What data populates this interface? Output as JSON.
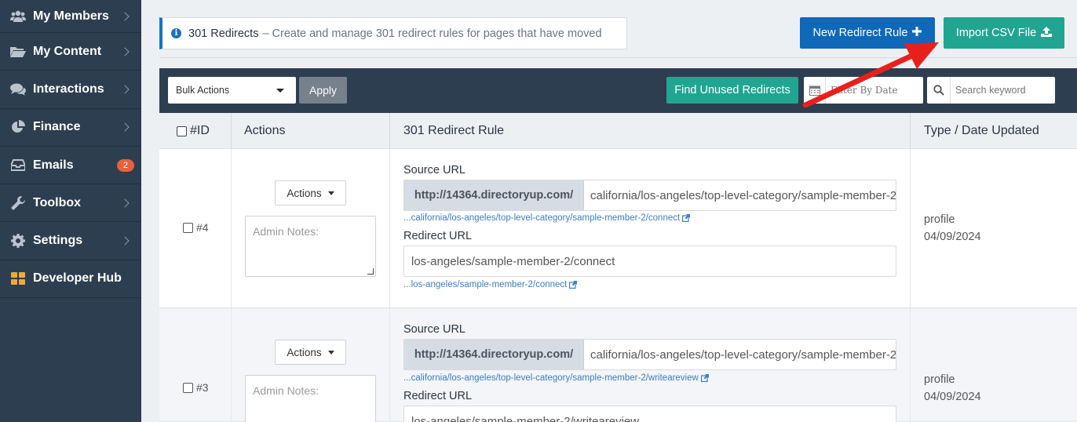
{
  "sidebar": {
    "items": [
      {
        "label": "My Members",
        "icon": "members-icon"
      },
      {
        "label": "My Content",
        "icon": "folder-icon"
      },
      {
        "label": "Interactions",
        "icon": "chat-icon"
      },
      {
        "label": "Finance",
        "icon": "pie-chart-icon"
      },
      {
        "label": "Emails",
        "icon": "inbox-icon",
        "badge": "2"
      },
      {
        "label": "Toolbox",
        "icon": "wrench-icon"
      },
      {
        "label": "Settings",
        "icon": "gear-icon"
      },
      {
        "label": "Developer Hub",
        "icon": "grid-icon"
      }
    ]
  },
  "header": {
    "info_title": "301 Redirects",
    "info_desc": "– Create and manage 301 redirect rules for pages that have moved",
    "new_rule_label": "New Redirect Rule",
    "import_label": "Import CSV File"
  },
  "toolbar": {
    "bulk_select_value": "Bulk Actions",
    "apply_label": "Apply",
    "find_unused_label": "Find Unused Redirects",
    "date_placeholder": "Filter By Date",
    "search_placeholder": "Search keyword"
  },
  "table": {
    "headers": {
      "id": "#ID",
      "actions": "Actions",
      "rule": "301 Redirect Rule",
      "type": "Type / Date Updated"
    },
    "source_label": "Source URL",
    "redirect_label": "Redirect URL",
    "base_url": "http://14364.directoryup.com/",
    "actions_label": "Actions",
    "notes_placeholder": "Admin Notes:",
    "rows": [
      {
        "id": "#4",
        "source": "california/los-angeles/top-level-category/sample-member-2/connect",
        "source_link": "...california/los-angeles/top-level-category/sample-member-2/connect",
        "redirect": "los-angeles/sample-member-2/connect",
        "redirect_link": "...los-angeles/sample-member-2/connect",
        "type": "profile",
        "date": "04/09/2024"
      },
      {
        "id": "#3",
        "source": "california/los-angeles/top-level-category/sample-member-2/writeareview",
        "source_link": "...california/los-angeles/top-level-category/sample-member-2/writeareview",
        "redirect": "los-angeles/sample-member-2/writeareview",
        "type": "profile",
        "date": "04/09/2024"
      }
    ]
  },
  "colors": {
    "sidebar_bg": "#2d3e50",
    "primary_blue": "#0f68b8",
    "teal": "#20a593",
    "badge": "#e8603c",
    "annotation_arrow": "#e8201c"
  }
}
